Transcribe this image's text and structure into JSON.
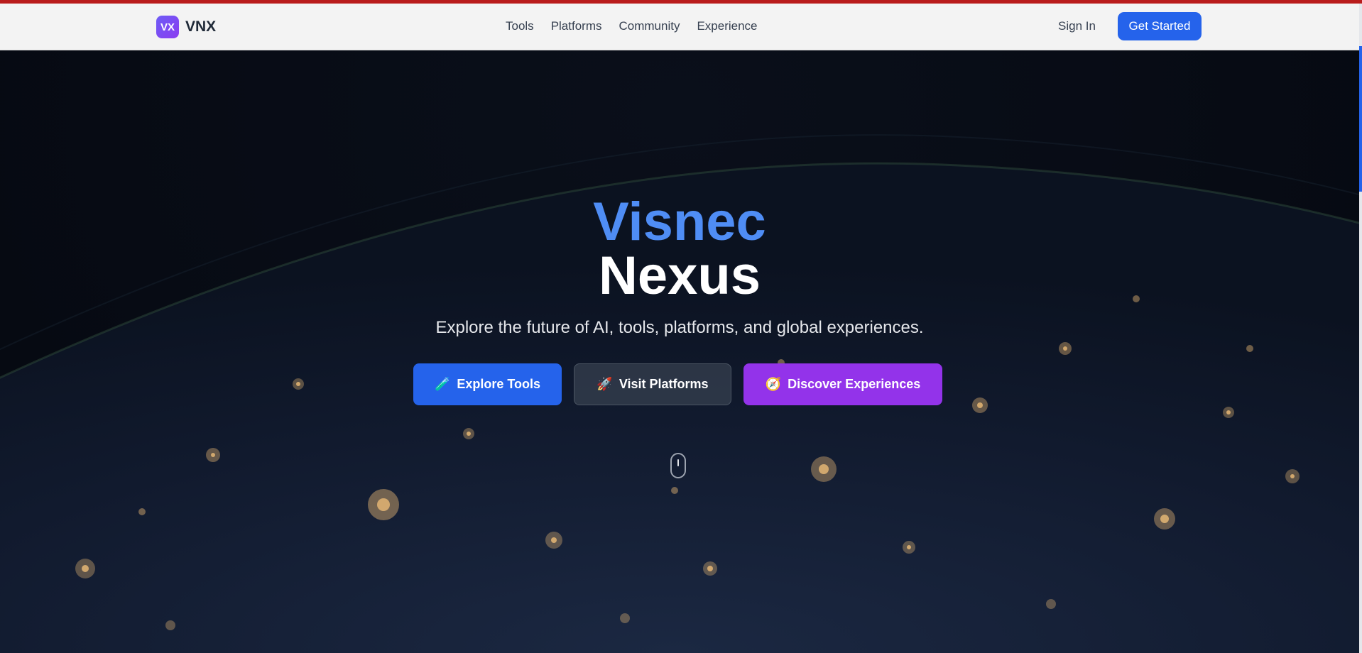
{
  "brand": {
    "mark": "VX",
    "name": "VNX"
  },
  "nav": {
    "links": [
      "Tools",
      "Platforms",
      "Community",
      "Experience"
    ],
    "sign_in": "Sign In",
    "get_started": "Get Started"
  },
  "hero": {
    "title_line1": "Visnec",
    "title_line2": "Nexus",
    "subtitle": "Explore the future of AI, tools, platforms, and global experiences.",
    "buttons": [
      {
        "icon": "🧪",
        "label": "Explore Tools"
      },
      {
        "icon": "🚀",
        "label": "Visit Platforms"
      },
      {
        "icon": "🧭",
        "label": "Discover Experiences"
      }
    ]
  },
  "colors": {
    "accent_blue": "#2563eb",
    "accent_purple": "#9333ea",
    "title_blue": "#4f8df5",
    "top_strip": "#b91c1c"
  }
}
